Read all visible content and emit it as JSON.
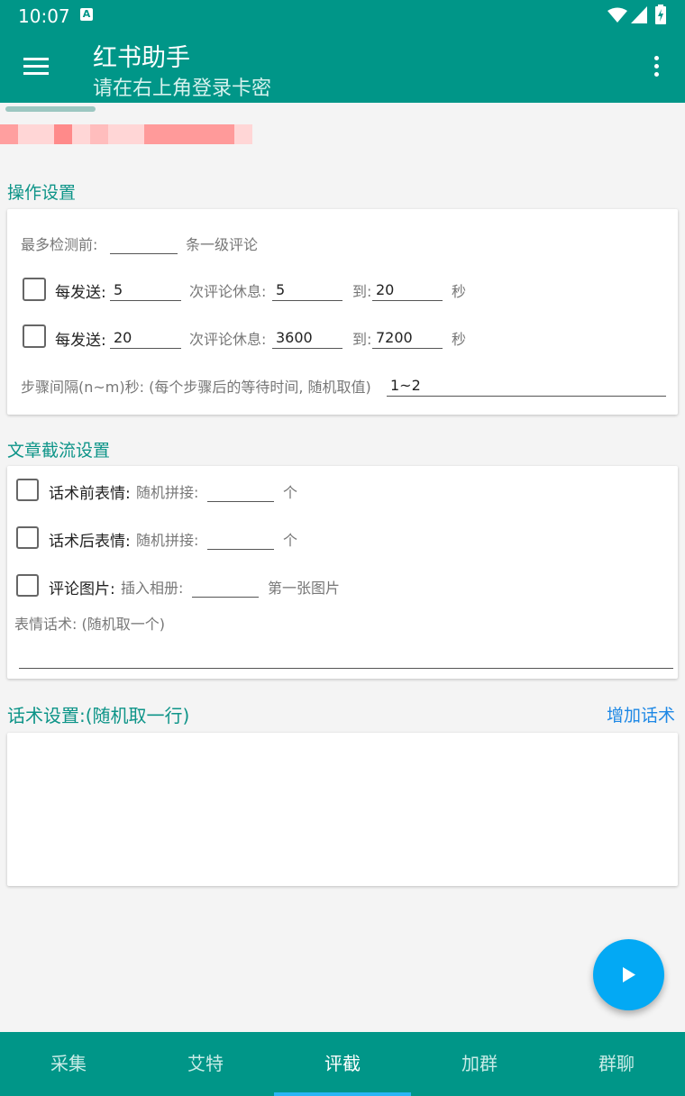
{
  "statusbar": {
    "time": "10:07",
    "notif_badge": "A"
  },
  "appbar": {
    "title": "红书助手",
    "subtitle": "请在右上角登录卡密"
  },
  "op": {
    "section_title": "操作设置",
    "max_check_label": "最多检测前:",
    "max_check_value": "",
    "max_check_suffix": "条一级评论",
    "rows": [
      {
        "send_label": "每发送:",
        "send_value": "5",
        "rest_label": "次评论休息:",
        "rest_from": "5",
        "to_label": "到:",
        "rest_to": "20",
        "unit": "秒"
      },
      {
        "send_label": "每发送:",
        "send_value": "20",
        "rest_label": "次评论休息:",
        "rest_from": "3600",
        "to_label": "到:",
        "rest_to": "7200",
        "unit": "秒"
      }
    ],
    "step_label": "步骤间隔(n~m)秒: (每个步骤后的等待时间, 随机取值)",
    "step_value": "1~2"
  },
  "article": {
    "section_title": "文章截流设置",
    "pre_label": "话术前表情:",
    "pre_sub": "随机拼接:",
    "pre_value": "",
    "pre_unit": "个",
    "post_label": "话术后表情:",
    "post_sub": "随机拼接:",
    "post_value": "",
    "post_unit": "个",
    "img_label": "评论图片:",
    "img_sub": "插入相册:",
    "img_value": "",
    "img_suffix": "第一张图片",
    "emoji_label": "表情话术: (随机取一个)",
    "emoji_value": ""
  },
  "script": {
    "section_title": "话术设置:(随机取一行)",
    "add_label": "增加话术",
    "content": ""
  },
  "tabs": [
    "采集",
    "艾特",
    "评截",
    "加群",
    "群聊"
  ],
  "active_tab": 2,
  "colors": {
    "primary": "#009688",
    "accent": "#03a9f4",
    "section_text": "#0d9488"
  },
  "icons": {
    "menu": "hamburger-menu-icon",
    "more": "more-vert-icon",
    "fab": "play-icon"
  }
}
